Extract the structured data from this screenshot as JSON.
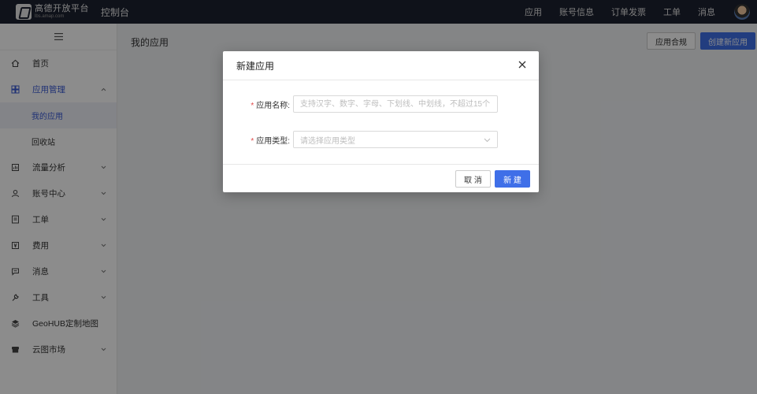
{
  "topbar": {
    "logo_title": "高德开放平台",
    "logo_sub": "lbs.amap.com",
    "console_title": "控制台",
    "nav": [
      "应用",
      "账号信息",
      "订单发票",
      "工单",
      "消息"
    ]
  },
  "sidebar": {
    "collapse_icon": "menu-icon",
    "items": [
      {
        "label": "首页",
        "icon": "home-icon"
      },
      {
        "label": "应用管理",
        "icon": "grid-icon",
        "expanded": true
      },
      {
        "label": "流量分析",
        "icon": "chart-icon"
      },
      {
        "label": "账号中心",
        "icon": "user-icon"
      },
      {
        "label": "工单",
        "icon": "ticket-icon"
      },
      {
        "label": "费用",
        "icon": "yuan-icon"
      },
      {
        "label": "消息",
        "icon": "message-icon"
      },
      {
        "label": "工具",
        "icon": "wrench-icon"
      },
      {
        "label": "GeoHUB定制地图",
        "icon": "layers-icon"
      },
      {
        "label": "云图市场",
        "icon": "store-icon"
      }
    ],
    "submenu": [
      "我的应用",
      "回收站"
    ]
  },
  "main": {
    "page_title": "我的应用",
    "compliance_button": "应用合规",
    "create_button": "创建新应用"
  },
  "modal": {
    "title": "新建应用",
    "name_label": "应用名称:",
    "name_placeholder": "支持汉字、数字、字母、下划线、中划线，不超过15个",
    "type_label": "应用类型:",
    "type_placeholder": "请选择应用类型",
    "cancel_label": "取 消",
    "ok_label": "新 建"
  },
  "colors": {
    "topbar": "#1d2230",
    "primary": "#3f6fe8",
    "required": "#e24a4a"
  }
}
